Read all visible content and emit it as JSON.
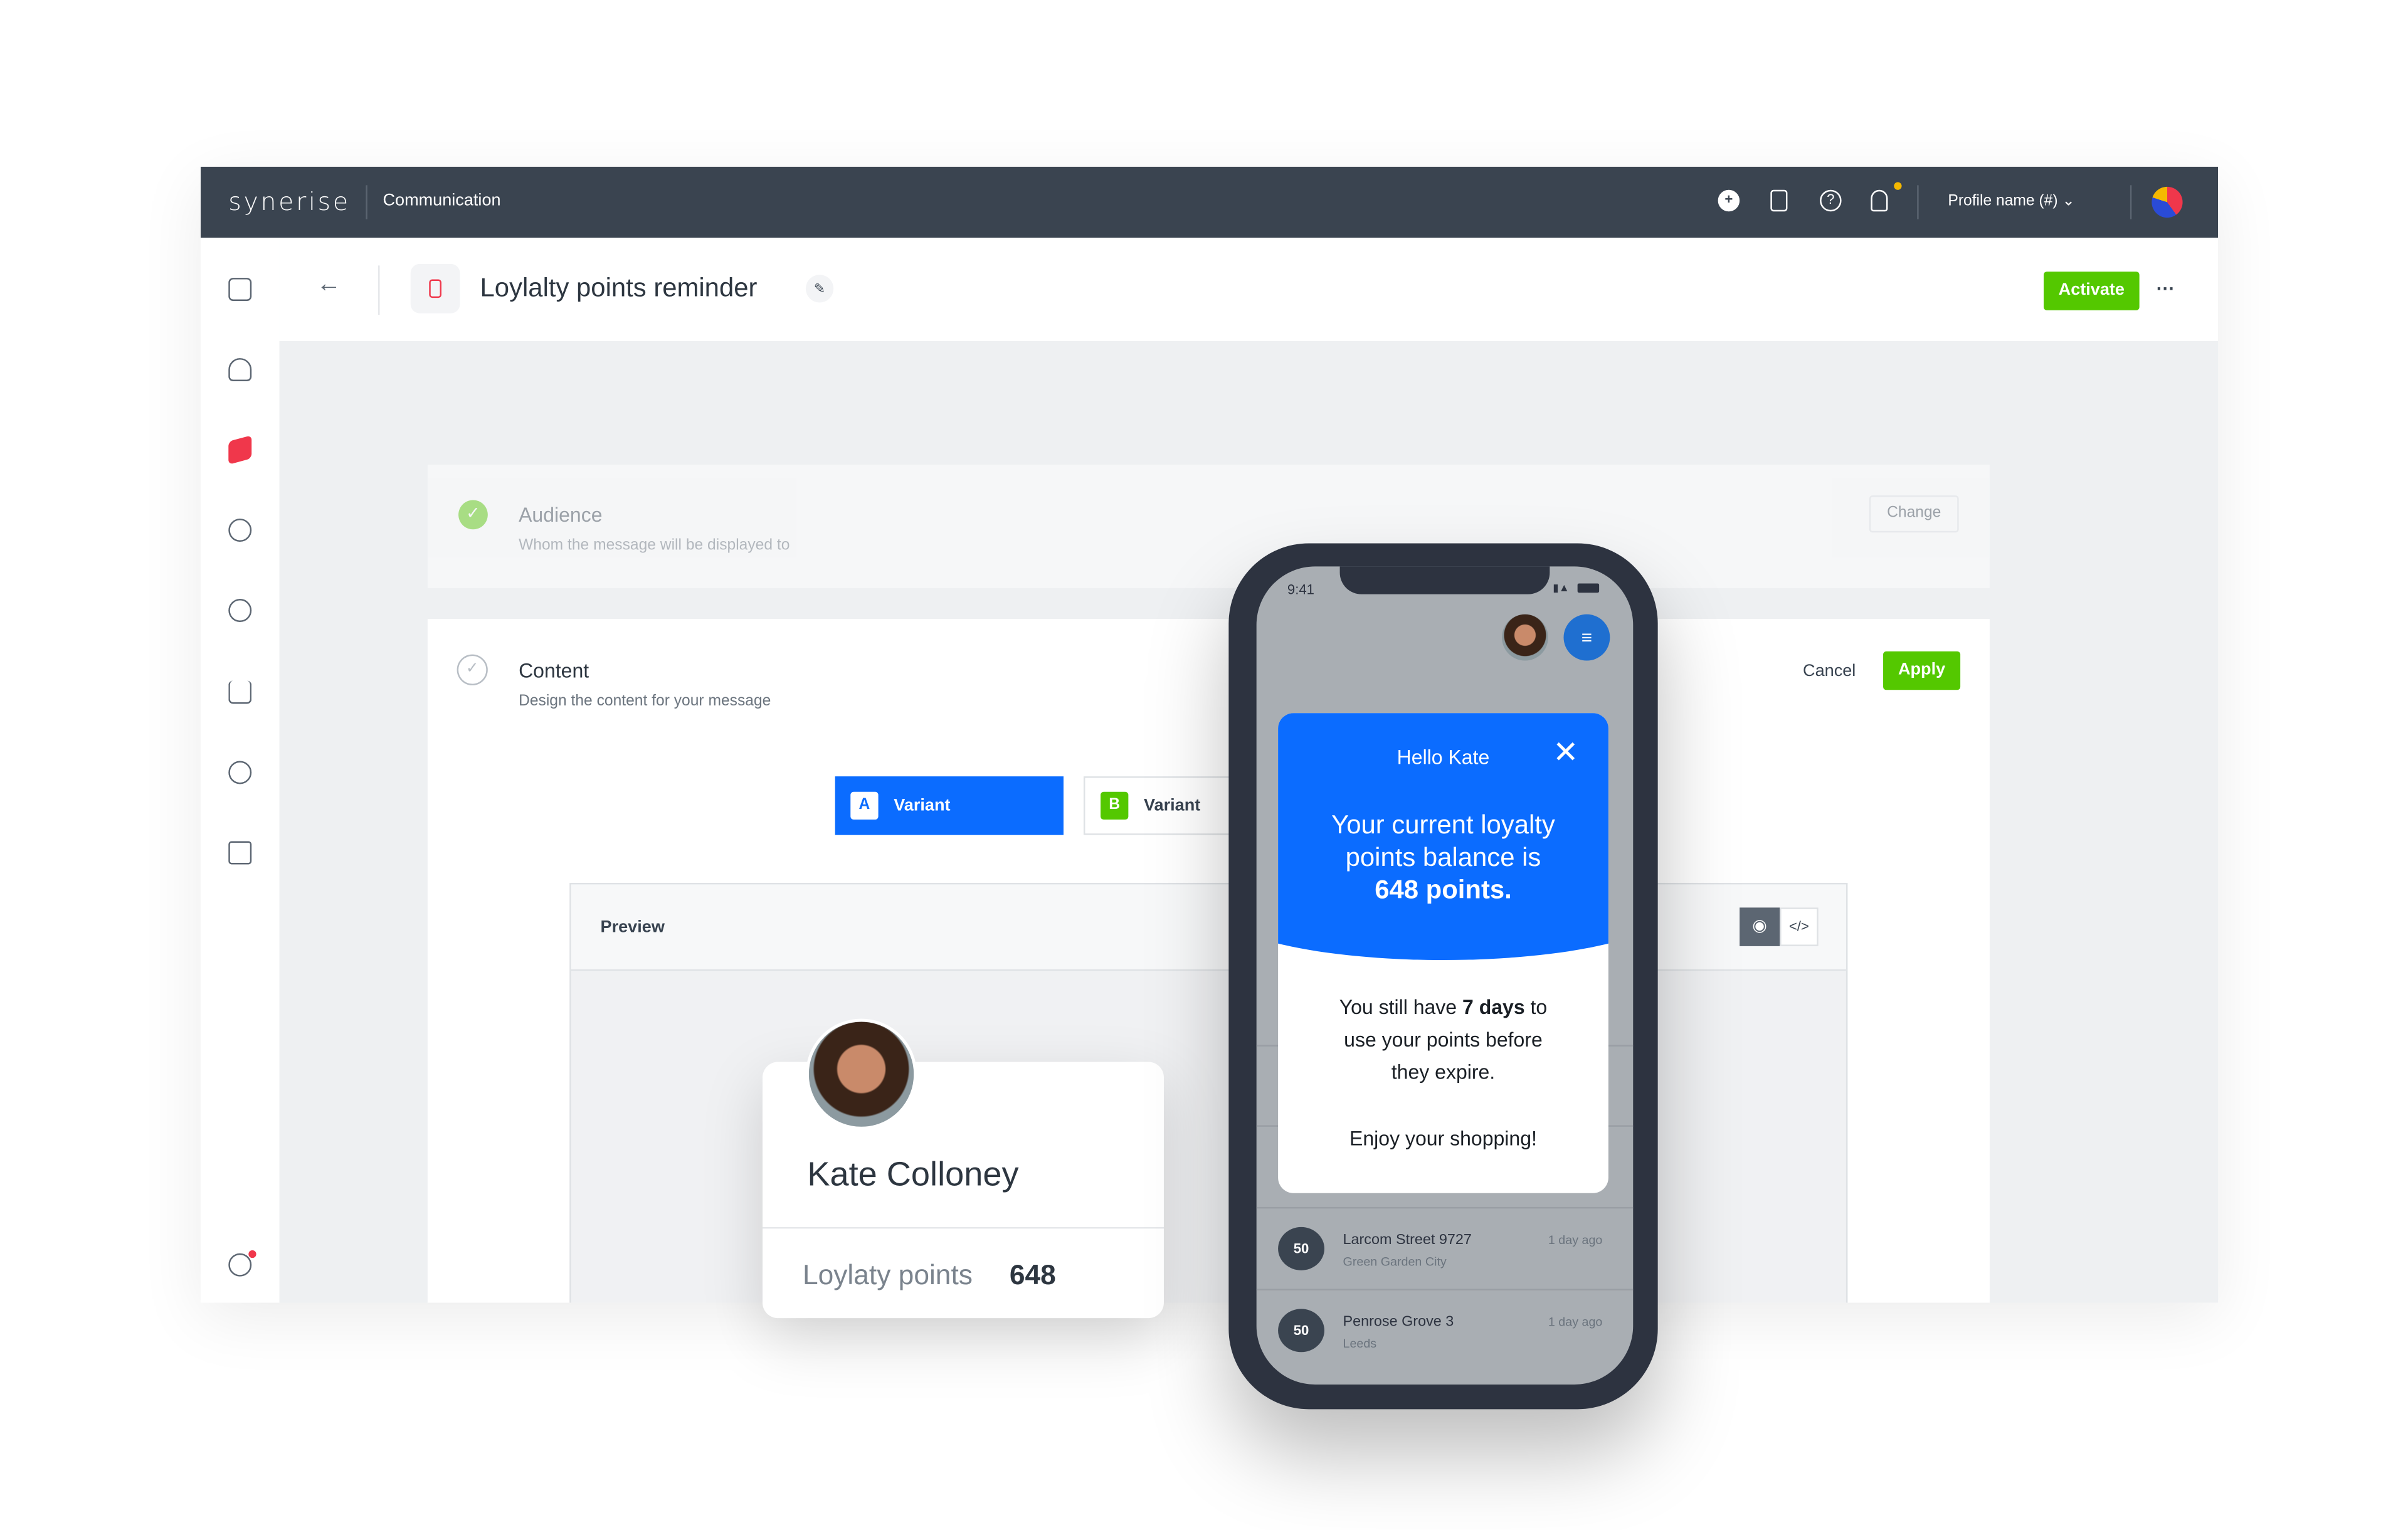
{
  "topbar": {
    "logo": "SYNERISE",
    "app": "Communication",
    "profile": "Profile name (#)",
    "icons": [
      "plus-circle-icon",
      "book-icon",
      "help-icon",
      "bell-icon"
    ]
  },
  "header": {
    "title": "Loylalty points reminder",
    "activate": "Activate",
    "more": "···"
  },
  "audience": {
    "title": "Audience",
    "subtitle": "Whom the message will be displayed to",
    "change": "Change"
  },
  "content": {
    "title": "Content",
    "subtitle": "Design the content for your message",
    "cancel": "Cancel",
    "apply": "Apply",
    "variants": [
      {
        "badge": "A",
        "label": "Variant"
      },
      {
        "badge": "B",
        "label": "Variant"
      }
    ],
    "preview": "Preview"
  },
  "profile_card": {
    "name": "Kate Colloney",
    "points_label": "Loylaty points",
    "points": "648"
  },
  "phone": {
    "time": "9:41",
    "popup": {
      "greeting": "Hello Kate",
      "headline1": "Your current loyalty",
      "headline2": "points balance is",
      "headline3": "648 points.",
      "body_pre": "You still have ",
      "body_bold": "7 days",
      "body_post": " to",
      "body2": "use your points before",
      "body3": "they expire.",
      "closing": "Enjoy your shopping!"
    },
    "list": [
      {
        "points": "50",
        "title": "Larcom Street 9727",
        "subtitle": "Green Garden City",
        "time": "1 day ago"
      },
      {
        "points": "50",
        "title": "Penrose Grove 3",
        "subtitle": "Leeds",
        "time": "1 day ago"
      }
    ]
  },
  "colors": {
    "topbar": "#3a4450",
    "green": "#54c800",
    "blue": "#0b6cff",
    "accent_red": "#f0374b"
  }
}
